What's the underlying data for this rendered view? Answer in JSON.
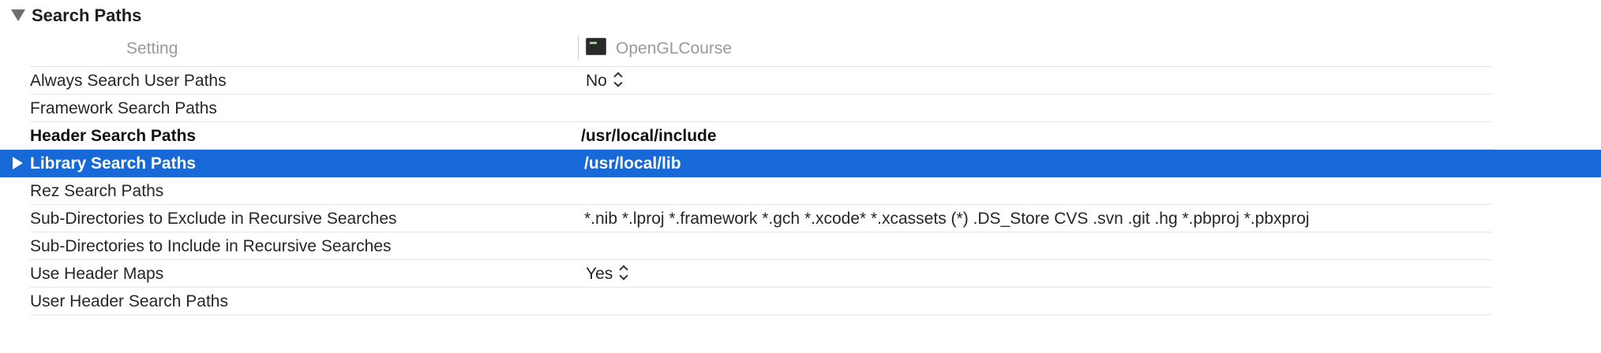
{
  "section": {
    "title": "Search Paths"
  },
  "columns": {
    "setting": "Setting",
    "target": "OpenGLCourse"
  },
  "rows": [
    {
      "label": "Always Search User Paths",
      "value": "No"
    },
    {
      "label": "Framework Search Paths",
      "value": ""
    },
    {
      "label": "Header Search Paths",
      "value": "/usr/local/include"
    },
    {
      "label": "Library Search Paths",
      "value": "/usr/local/lib"
    },
    {
      "label": "Rez Search Paths",
      "value": ""
    },
    {
      "label": "Sub-Directories to Exclude in Recursive Searches",
      "value": "*.nib *.lproj *.framework *.gch *.xcode* *.xcassets (*) .DS_Store CVS .svn .git .hg *.pbproj *.pbxproj"
    },
    {
      "label": "Sub-Directories to Include in Recursive Searches",
      "value": ""
    },
    {
      "label": "Use Header Maps",
      "value": "Yes"
    },
    {
      "label": "User Header Search Paths",
      "value": ""
    }
  ],
  "colors": {
    "selection": "#1769d8",
    "section_triangle": "#6e6e6e"
  },
  "icons": {
    "section_toggle": "disclosure-triangle-down-icon",
    "row_toggle": "disclosure-triangle-right-icon",
    "target": "terminal-app-icon",
    "popup": "up-down-chevron-icon"
  }
}
